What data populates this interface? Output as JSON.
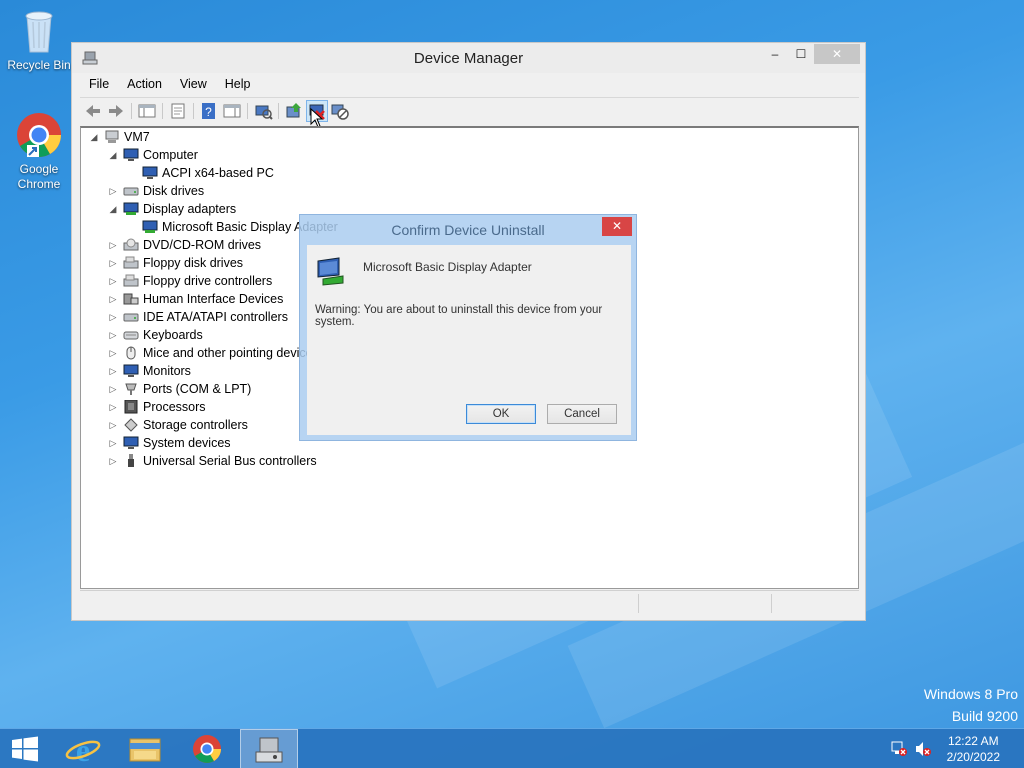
{
  "desktop": {
    "icons": [
      {
        "label": "Recycle Bin"
      },
      {
        "label": "Google Chrome"
      }
    ],
    "watermark": {
      "line1": "Windows 8 Pro",
      "line2": "Build 9200"
    }
  },
  "window": {
    "title": "Device Manager",
    "controls": {
      "minimize": "–",
      "maximize": "☐",
      "close": "✕"
    },
    "menu": [
      "File",
      "Action",
      "View",
      "Help"
    ],
    "toolbar_icons": [
      "back-icon",
      "forward-icon",
      "show-hide-console-tree-icon",
      "properties-icon",
      "help-icon",
      "action-pane-icon",
      "scan-hardware-icon",
      "update-driver-icon",
      "uninstall-device-icon",
      "disable-device-icon"
    ]
  },
  "tree": {
    "root": "VM7",
    "nodes": [
      {
        "label": "Computer",
        "expanded": true
      },
      {
        "label": "ACPI x64-based PC",
        "child": true
      },
      {
        "label": "Disk drives",
        "expanded": false
      },
      {
        "label": "Display adapters",
        "expanded": true
      },
      {
        "label": "Microsoft Basic Display Adapter",
        "child": true
      },
      {
        "label": "DVD/CD-ROM drives",
        "expanded": false
      },
      {
        "label": "Floppy disk drives",
        "expanded": false
      },
      {
        "label": "Floppy drive controllers",
        "expanded": false
      },
      {
        "label": "Human Interface Devices",
        "expanded": false
      },
      {
        "label": "IDE ATA/ATAPI controllers",
        "expanded": false
      },
      {
        "label": "Keyboards",
        "expanded": false
      },
      {
        "label": "Mice and other pointing devices",
        "expanded": false
      },
      {
        "label": "Monitors",
        "expanded": false
      },
      {
        "label": "Ports (COM & LPT)",
        "expanded": false
      },
      {
        "label": "Processors",
        "expanded": false
      },
      {
        "label": "Storage controllers",
        "expanded": false
      },
      {
        "label": "System devices",
        "expanded": false
      },
      {
        "label": "Universal Serial Bus controllers",
        "expanded": false
      }
    ]
  },
  "dialog": {
    "title": "Confirm Device Uninstall",
    "close": "✕",
    "device_name": "Microsoft Basic Display Adapter",
    "warning": "Warning: You are about to uninstall this device from your system.",
    "ok": "OK",
    "cancel": "Cancel"
  },
  "taskbar": {
    "items": [
      "start-button",
      "internet-explorer",
      "file-explorer",
      "google-chrome",
      "device-manager"
    ],
    "clock": {
      "time": "12:22 AM",
      "date": "2/20/2022"
    }
  },
  "colors": {
    "desktop": "#3a9be6",
    "taskbar": "#2873be",
    "dialog_frame": "#aacdf0",
    "close_red": "#d84545"
  }
}
